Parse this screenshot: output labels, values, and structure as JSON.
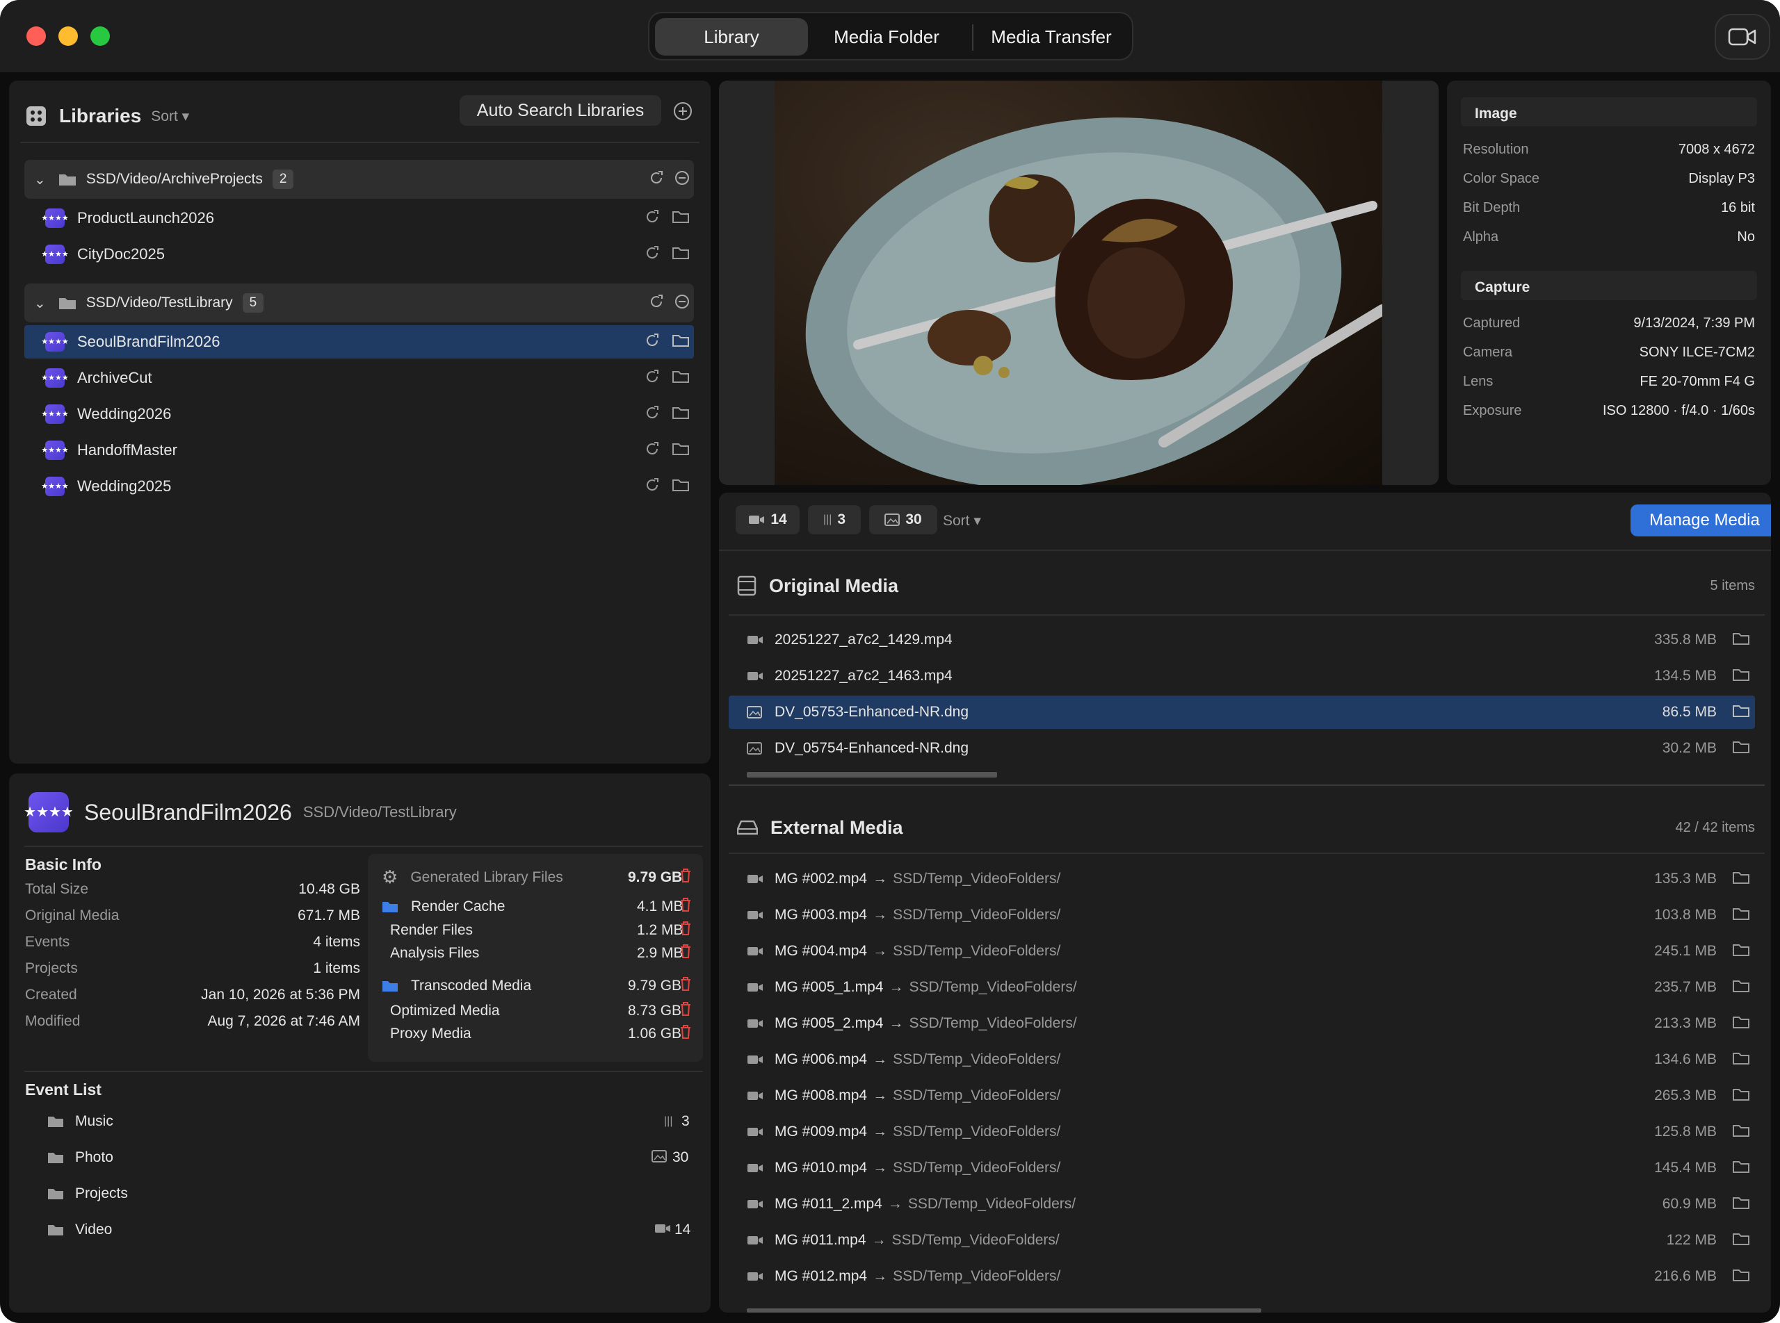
{
  "titlebar": {
    "tabs": [
      "Library",
      "Media Folder",
      "Media Transfer"
    ],
    "active_tab": "Library"
  },
  "libraries": {
    "title": "Libraries",
    "sort_label": "Sort",
    "auto_search_label": "Auto Search Libraries",
    "groups": [
      {
        "path": "SSD/Video/ArchiveProjects",
        "count": "2",
        "items": [
          "ProductLaunch2026",
          "CityDoc2025"
        ]
      },
      {
        "path": "SSD/Video/TestLibrary",
        "count": "5",
        "items": [
          "SeoulBrandFilm2026",
          "ArchiveCut",
          "Wedding2026",
          "HandoffMaster",
          "Wedding2025"
        ]
      }
    ],
    "selected": "SeoulBrandFilm2026"
  },
  "library_detail": {
    "name": "SeoulBrandFilm2026",
    "path": "SSD/Video/TestLibrary",
    "basic_info_title": "Basic Info",
    "basic_info": [
      {
        "label": "Total Size",
        "value": "10.48 GB"
      },
      {
        "label": "Original Media",
        "value": "671.7 MB"
      },
      {
        "label": "Events",
        "value": "4 items"
      },
      {
        "label": "Projects",
        "value": "1 items"
      },
      {
        "label": "Created",
        "value": "Jan 10, 2026 at 5:36 PM"
      },
      {
        "label": "Modified",
        "value": "Aug 7, 2026 at 7:46 AM"
      }
    ],
    "generated": {
      "title": "Generated Library Files",
      "total": "9.79 GB",
      "render_cache": {
        "label": "Render Cache",
        "value": "4.1 MB"
      },
      "render_files": {
        "label": "Render Files",
        "value": "1.2 MB"
      },
      "analysis_files": {
        "label": "Analysis Files",
        "value": "2.9 MB"
      },
      "transcoded": {
        "label": "Transcoded Media",
        "value": "9.79 GB"
      },
      "optimized": {
        "label": "Optimized Media",
        "value": "8.73 GB"
      },
      "proxy": {
        "label": "Proxy Media",
        "value": "1.06 GB"
      }
    },
    "event_list_title": "Event List",
    "events": [
      {
        "name": "Music",
        "kind": "audio",
        "count": "3"
      },
      {
        "name": "Photo",
        "kind": "image",
        "count": "30"
      },
      {
        "name": "Projects",
        "kind": "none",
        "count": ""
      },
      {
        "name": "Video",
        "kind": "video",
        "count": "14"
      }
    ]
  },
  "inspector": {
    "image_title": "Image",
    "image_rows": [
      {
        "label": "Resolution",
        "value": "7008 x 4672"
      },
      {
        "label": "Color Space",
        "value": "Display P3"
      },
      {
        "label": "Bit Depth",
        "value": "16 bit"
      },
      {
        "label": "Alpha",
        "value": "No"
      }
    ],
    "capture_title": "Capture",
    "capture_rows": [
      {
        "label": "Captured",
        "value": "9/13/2024, 7:39 PM"
      },
      {
        "label": "Camera",
        "value": "SONY ILCE-7CM2"
      },
      {
        "label": "Lens",
        "value": "FE 20-70mm F4 G"
      },
      {
        "label": "Exposure",
        "value": "ISO 12800 · f/4.0 · 1/60s"
      }
    ]
  },
  "media_toolbar": {
    "video_count": "14",
    "audio_count": "3",
    "image_count": "30",
    "sort_label": "Sort",
    "manage_label": "Manage Media"
  },
  "original_media": {
    "title": "Original Media",
    "count_label": "5 items",
    "files": [
      {
        "name": "20251227_a7c2_1429.mp4",
        "size": "335.8 MB",
        "kind": "video"
      },
      {
        "name": "20251227_a7c2_1463.mp4",
        "size": "134.5 MB",
        "kind": "video"
      },
      {
        "name": "DV_05753-Enhanced-NR.dng",
        "size": "86.5 MB",
        "kind": "image"
      },
      {
        "name": "DV_05754-Enhanced-NR.dng",
        "size": "30.2 MB",
        "kind": "image"
      }
    ],
    "selected": "DV_05753-Enhanced-NR.dng"
  },
  "external_media": {
    "title": "External Media",
    "count_label": "42 / 42 items",
    "files": [
      {
        "name": "MG #002.mp4",
        "dest": "SSD/Temp_VideoFolders/",
        "size": "135.3 MB"
      },
      {
        "name": "MG #003.mp4",
        "dest": "SSD/Temp_VideoFolders/",
        "size": "103.8 MB"
      },
      {
        "name": "MG #004.mp4",
        "dest": "SSD/Temp_VideoFolders/",
        "size": "245.1 MB"
      },
      {
        "name": "MG #005_1.mp4",
        "dest": "SSD/Temp_VideoFolders/",
        "size": "235.7 MB"
      },
      {
        "name": "MG #005_2.mp4",
        "dest": "SSD/Temp_VideoFolders/",
        "size": "213.3 MB"
      },
      {
        "name": "MG #006.mp4",
        "dest": "SSD/Temp_VideoFolders/",
        "size": "134.6 MB"
      },
      {
        "name": "MG #008.mp4",
        "dest": "SSD/Temp_VideoFolders/",
        "size": "265.3 MB"
      },
      {
        "name": "MG #009.mp4",
        "dest": "SSD/Temp_VideoFolders/",
        "size": "125.8 MB"
      },
      {
        "name": "MG #010.mp4",
        "dest": "SSD/Temp_VideoFolders/",
        "size": "145.4 MB"
      },
      {
        "name": "MG #011_2.mp4",
        "dest": "SSD/Temp_VideoFolders/",
        "size": "60.9 MB"
      },
      {
        "name": "MG #011.mp4",
        "dest": "SSD/Temp_VideoFolders/",
        "size": "122 MB"
      },
      {
        "name": "MG #012.mp4",
        "dest": "SSD/Temp_VideoFolders/",
        "size": "216.6 MB"
      }
    ]
  },
  "colors": {
    "accent": "#2f6fd8",
    "selection": "#1f3a63",
    "danger": "#e0443e",
    "library_icon": "#5b46e0"
  }
}
